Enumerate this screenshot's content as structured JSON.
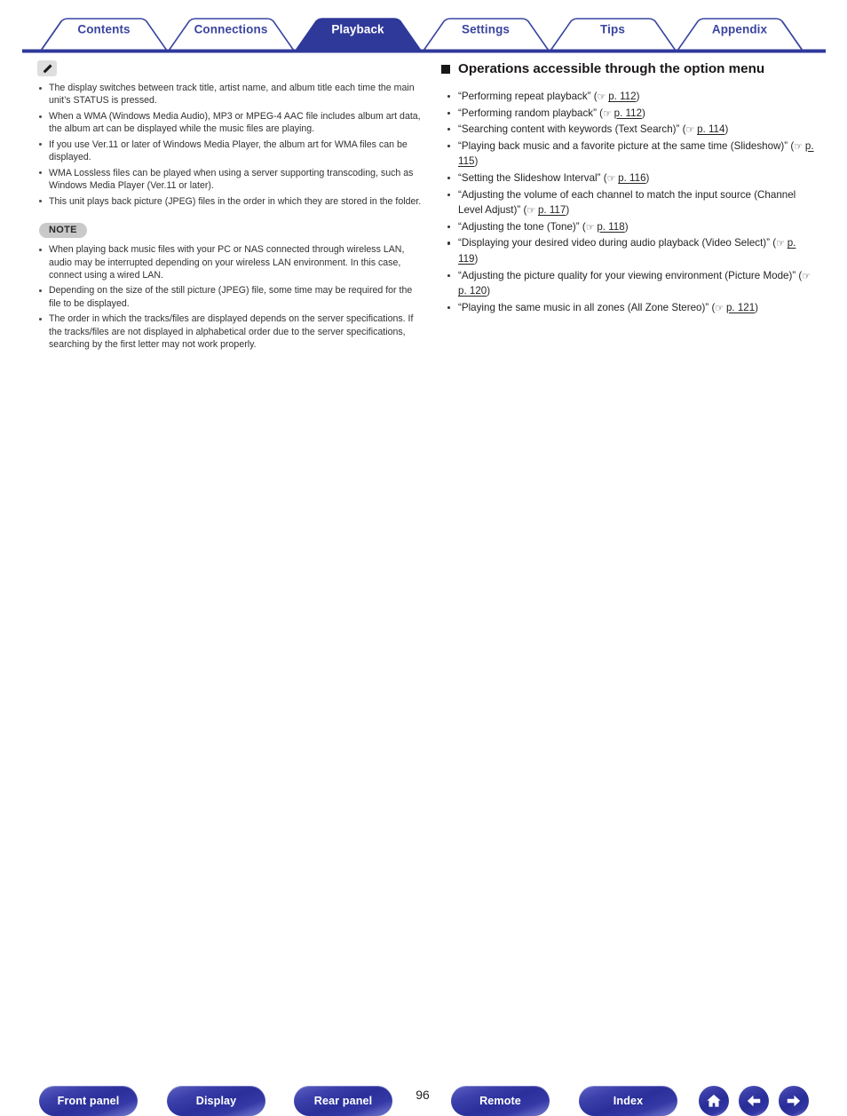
{
  "tabs": [
    {
      "label": "Contents",
      "active": false
    },
    {
      "label": "Connections",
      "active": false
    },
    {
      "label": "Playback",
      "active": true
    },
    {
      "label": "Settings",
      "active": false
    },
    {
      "label": "Tips",
      "active": false
    },
    {
      "label": "Appendix",
      "active": false
    }
  ],
  "left_column": {
    "tip_icon": "pencil-icon",
    "tip_items": [
      "The display switches between track title, artist name, and album title each time the main unit’s STATUS is pressed.",
      "When a WMA (Windows Media Audio), MP3 or MPEG-4 AAC file includes album art data, the album art can be displayed while the music files are playing.",
      "If you use Ver.11 or later of Windows Media Player, the album art for WMA files can be displayed.",
      "WMA Lossless files can be played when using a server supporting transcoding, such as Windows Media Player (Ver.11 or later).",
      "This unit plays back picture (JPEG) files in the order in which they are stored in the folder."
    ],
    "note_label": "NOTE",
    "note_items": [
      "When playing back music files with your PC or NAS connected through wireless LAN, audio may be interrupted depending on your wireless LAN environment. In this case, connect using a wired LAN.",
      "Depending on the size of the still picture (JPEG) file, some time may be required for the file to be displayed.",
      "The order in which the tracks/files are displayed depends on the server specifications. If the tracks/files are not displayed in alphabetical order due to the server specifications, searching by the first letter may not work properly."
    ]
  },
  "right_column": {
    "heading": "Operations accessible through the option menu",
    "hand_glyph": "☞",
    "links": [
      {
        "text": "“Performing repeat playback”",
        "page": "p. 112"
      },
      {
        "text": "“Performing random playback”",
        "page": "p. 112"
      },
      {
        "text": "“Searching content with keywords (Text Search)”",
        "page": "p. 114"
      },
      {
        "text": "“Playing back music and a favorite picture at the same time (Slideshow)”",
        "page": "p. 115"
      },
      {
        "text": "“Setting the Slideshow Interval”",
        "page": "p. 116"
      },
      {
        "text": "“Adjusting the volume of each channel to match the input source (Channel Level Adjust)”",
        "page": "p. 117"
      },
      {
        "text": "“Adjusting the tone (Tone)”",
        "page": "p. 118"
      },
      {
        "text": "“Displaying your desired video during audio playback (Video Select)”",
        "page": "p. 119"
      },
      {
        "text": "“Adjusting the picture quality for your viewing environment (Picture Mode)”",
        "page": "p. 120"
      },
      {
        "text": "“Playing the same music in all zones (All Zone Stereo)”",
        "page": "p. 121"
      }
    ]
  },
  "footer": {
    "front_panel": "Front panel",
    "display": "Display",
    "rear_panel": "Rear panel",
    "page_number": "96",
    "remote": "Remote",
    "index": "Index",
    "home_icon": "home-icon",
    "back_icon": "arrow-left-icon",
    "next_icon": "arrow-right-icon"
  },
  "colors": {
    "tab_blue": "#3a45a0",
    "tab_active_bg": "#2f399a",
    "button_blue": "#2a2f9a",
    "note_gray": "#c9c9c9"
  }
}
